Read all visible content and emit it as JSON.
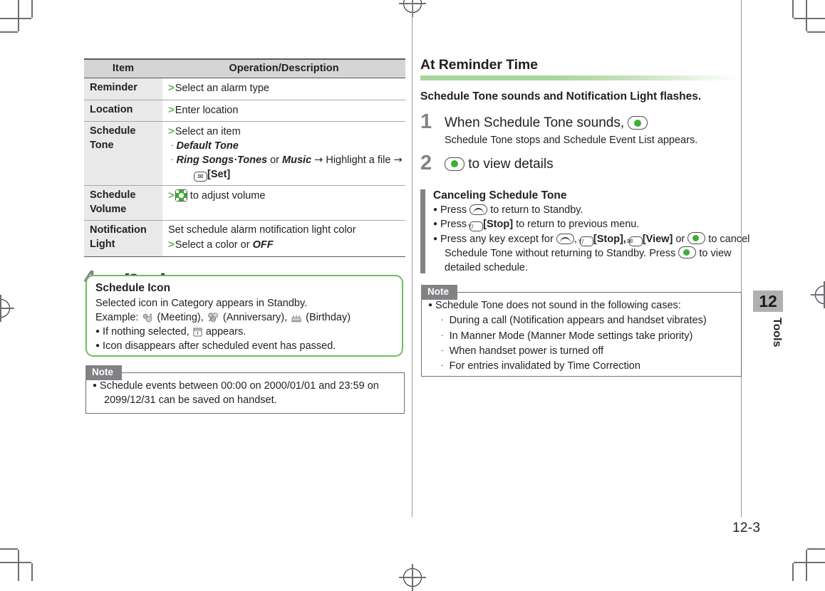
{
  "document": {
    "folio": "12-3",
    "chapter_number": "12",
    "chapter_name": "Tools"
  },
  "left_column": {
    "table": {
      "headers": [
        "Item",
        "Operation/Description"
      ],
      "rows": [
        {
          "item": "Reminder",
          "lines": [
            {
              "type": "gt",
              "text": "Select an alarm type"
            }
          ]
        },
        {
          "item": "Location",
          "lines": [
            {
              "type": "gt",
              "text": "Enter location"
            }
          ]
        },
        {
          "item": "Schedule Tone",
          "lines": [
            {
              "type": "gt",
              "text": "Select an item"
            },
            {
              "type": "sub",
              "text": "Default Tone"
            },
            {
              "type": "sub",
              "text": "Ring Songs·Tones or Music → Highlight a file →"
            },
            {
              "type": "sub2",
              "text": "[Set]"
            }
          ]
        },
        {
          "item": "Schedule Volume",
          "lines": [
            {
              "type": "gt-icon",
              "text": "to adjust volume"
            }
          ]
        },
        {
          "item": "Notification Light",
          "lines": [
            {
              "type": "plain",
              "text": "Set schedule alarm notification light color"
            },
            {
              "type": "gt",
              "text": "Select a color or OFF"
            }
          ]
        }
      ]
    },
    "step4": {
      "number": "4",
      "label": "[Save]"
    },
    "schedule_icon_callout": {
      "title": "Schedule Icon",
      "line1": "Selected icon in Category appears in Standby.",
      "example_prefix": "Example:",
      "example_items": [
        {
          "icon": "meeting-icon",
          "label": "(Meeting),"
        },
        {
          "icon": "anniversary-icon",
          "label": "(Anniversary),"
        },
        {
          "icon": "birthday-icon",
          "label": "(Birthday)"
        }
      ],
      "bullets": [
        {
          "pre": "If nothing selected,",
          "icon": "calendar-icon",
          "post": "appears."
        },
        {
          "pre": "Icon disappears after scheduled event has passed.",
          "icon": "",
          "post": ""
        }
      ]
    },
    "note": {
      "tab": "Note",
      "bullets": [
        "Schedule events between 00:00 on 2000/01/01 and 23:59 on 2099/12/31 can be saved on handset."
      ]
    }
  },
  "right_column": {
    "heading": "At Reminder Time",
    "lead": "Schedule Tone sounds and Notification Light flashes.",
    "steps": [
      {
        "number": "1",
        "text": "When Schedule Tone sounds,",
        "key": "center-key-icon",
        "sub": "Schedule Tone stops and Schedule Event List appears."
      },
      {
        "number": "2",
        "text": "to view details",
        "key": "center-key-icon",
        "sub": ""
      }
    ],
    "canceling": {
      "title": "Canceling Schedule Tone",
      "bullets": [
        {
          "parts": [
            "Press",
            "END-KEY",
            "to return to Standby."
          ]
        },
        {
          "parts": [
            "Press",
            "SOFT-KEY",
            "[Stop] to return to previous menu."
          ]
        },
        {
          "parts": [
            "Press any key except for",
            "END-KEY",
            ", ",
            "SOFT-KEY",
            "[Stop], ",
            "MAIL-KEY",
            "[View] or ",
            "CENTER-KEY",
            " to cancel Schedule Tone without returning to Standby. Press",
            "CENTER-KEY",
            "to view detailed schedule."
          ]
        }
      ],
      "bullet1_pre": "Press",
      "bullet1_post": "to return to Standby.",
      "bullet2_pre": "Press",
      "bullet2_bold": "[Stop]",
      "bullet2_post": "to return to previous menu.",
      "bullet3_pre": "Press any key except for",
      "bullet3_stop": "[Stop],",
      "bullet3_view": "[View]",
      "bullet3_or": "or",
      "bullet3_mid": "to cancel",
      "bullet3_line2a": "Schedule Tone without returning to Standby. Press",
      "bullet3_line2b": "to view",
      "bullet3_line3": "detailed schedule."
    },
    "note": {
      "tab": "Note",
      "bullet": "Schedule Tone does not sound in the following cases:",
      "sub_items": [
        "During a call (Notification appears and handset vibrates)",
        "In Manner Mode (Manner Mode settings take priority)",
        "When handset power is turned off",
        "For entries invalidated by Time Correction"
      ]
    }
  },
  "colors": {
    "accent_green": "#5bba47",
    "callout_border": "#6fbf5b",
    "gray_bar": "#808285",
    "header_gray": "#d5d5d5",
    "item_gray": "#e9e9e9"
  }
}
